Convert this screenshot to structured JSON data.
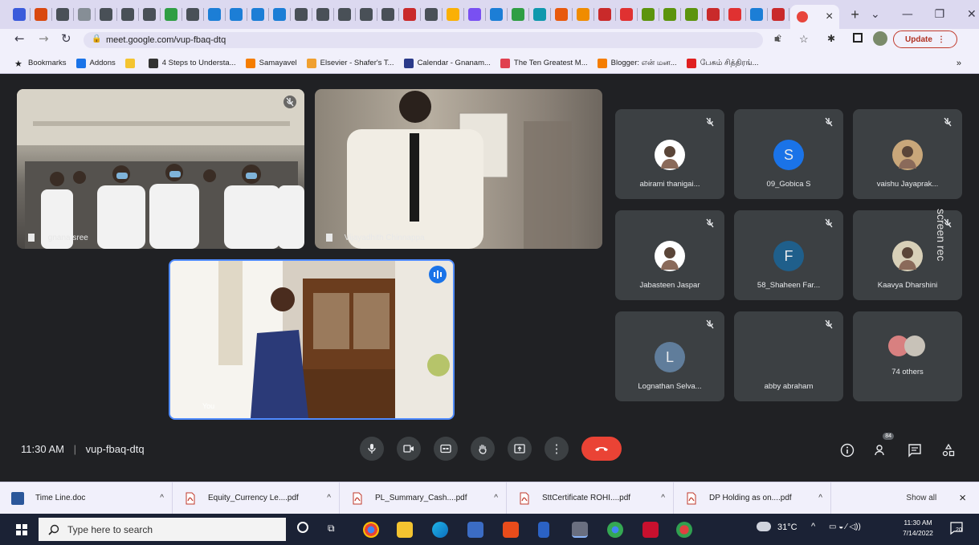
{
  "browser": {
    "url": "meet.google.com/vup-fbaq-dtq",
    "update_label": "Update",
    "tab_close": "×",
    "new_tab": "+",
    "bookmarks": [
      {
        "label": "Bookmarks",
        "icon": "star-icon",
        "color": "#202124"
      },
      {
        "label": "Addons",
        "icon": "addons-icon",
        "color": "#1a73e8"
      },
      {
        "label": "",
        "icon": "folder-icon",
        "color": "#f4c430"
      },
      {
        "label": "4 Steps to Understa...",
        "icon": "book-icon",
        "color": "#333333"
      },
      {
        "label": "Samayavel",
        "icon": "blogger-icon",
        "color": "#f57d00"
      },
      {
        "label": "Elsevier - Shafer's T...",
        "icon": "elsevier-icon",
        "color": "#f0a030"
      },
      {
        "label": "Calendar - Gnanam...",
        "icon": "calendar-icon",
        "color": "#2a3a8a"
      },
      {
        "label": "The Ten Greatest M...",
        "icon": "page-icon",
        "color": "#e04050"
      },
      {
        "label": "Blogger: என் மன...",
        "icon": "blogger-icon",
        "color": "#f57d00"
      },
      {
        "label": "பேசும் சித்திரங்...",
        "icon": "youtube-icon",
        "color": "#e02020"
      }
    ],
    "more_bookmarks": "»"
  },
  "meet": {
    "tiles": [
      {
        "name": "gnana sree"
      },
      {
        "name": "Vijayadhith Chinnappa"
      },
      {
        "name": "You"
      }
    ],
    "grid": [
      {
        "name": "abirami thanigai...",
        "avatar": "photo",
        "letter": "",
        "color": "#ffffff"
      },
      {
        "name": "09_Gobica S",
        "avatar": "letter",
        "letter": "S",
        "color": "#1a73e8"
      },
      {
        "name": "vaishu Jayaprak...",
        "avatar": "photo",
        "letter": "",
        "color": "#c9a77a"
      },
      {
        "name": "Jabasteen Jaspar",
        "avatar": "photo",
        "letter": "",
        "color": "#ffffff"
      },
      {
        "name": "58_Shaheen Far...",
        "avatar": "letter",
        "letter": "F",
        "color": "#1f5f8b"
      },
      {
        "name": "Kaavya Dharshini",
        "avatar": "photo",
        "letter": "",
        "color": "#d8d0b8"
      },
      {
        "name": "Lognathan Selva...",
        "avatar": "letter",
        "letter": "L",
        "color": "#607d9b"
      },
      {
        "name": "abby abraham",
        "avatar": "none",
        "letter": "",
        "color": "#2d2e30"
      },
      {
        "name": "74 others",
        "avatar": "group",
        "letter": "",
        "color": "#d88080"
      }
    ],
    "watermark": "screen rec",
    "time": "11:30 AM",
    "separator": "|",
    "meeting_code": "vup-fbaq-dtq",
    "participant_count": "84",
    "end_call_color": "#ea4335"
  },
  "downloads": {
    "items": [
      {
        "name": "Time Line.doc",
        "icon": "word-doc-icon"
      },
      {
        "name": "Equity_Currency Le....pdf",
        "icon": "pdf-icon"
      },
      {
        "name": "PL_Summary_Cash....pdf",
        "icon": "pdf-icon"
      },
      {
        "name": "SttCertificate ROHI....pdf",
        "icon": "pdf-icon"
      },
      {
        "name": "DP Holding as on....pdf",
        "icon": "pdf-icon"
      }
    ],
    "show_all": "Show all",
    "close": "×",
    "caret": "^"
  },
  "taskbar": {
    "search_placeholder": "Type here to search",
    "temperature": "31°C",
    "clock_time": "11:30 AM",
    "clock_date": "7/14/2022",
    "notification_count": "20"
  }
}
